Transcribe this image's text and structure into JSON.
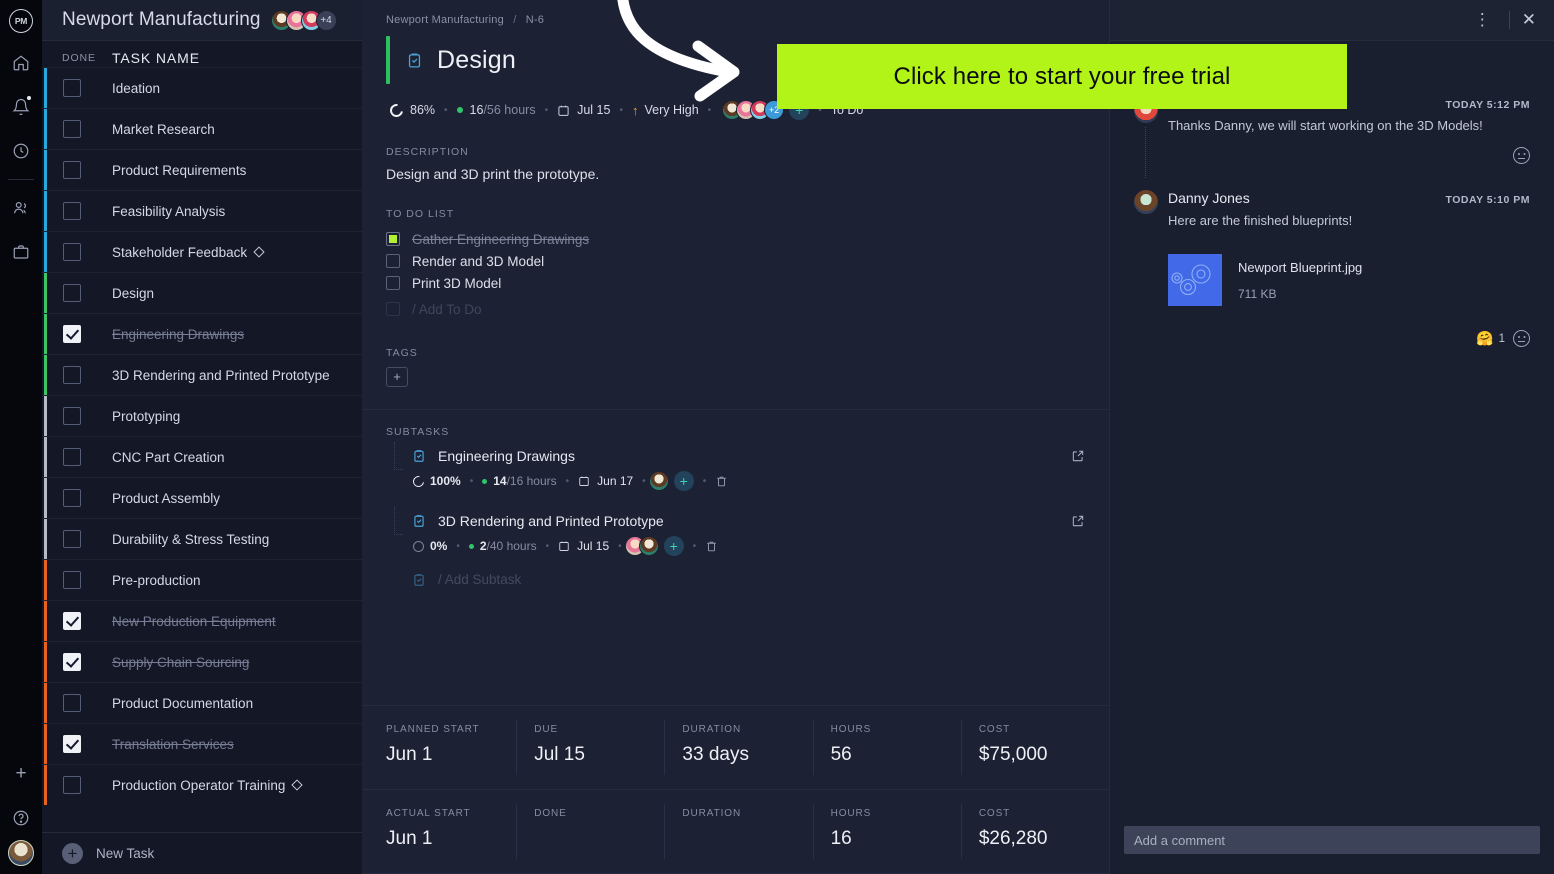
{
  "rail": {
    "logo_text": "PM",
    "items": [
      {
        "name": "home-icon",
        "label": "Home"
      },
      {
        "name": "notifications-icon",
        "label": "Notifications"
      },
      {
        "name": "time-icon",
        "label": "Timesheets"
      },
      {
        "name": "people-icon",
        "label": "People"
      },
      {
        "name": "portfolio-icon",
        "label": "Portfolio"
      }
    ],
    "add_label": "+",
    "help_label": "?"
  },
  "tasklist": {
    "project_title": "Newport Manufacturing",
    "avatars_overflow": "+4",
    "columns": {
      "done": "DONE",
      "task_name": "TASK NAME"
    },
    "new_task_label": "New Task",
    "rows": [
      {
        "name": "Ideation",
        "done": false,
        "color": "#29a8dc",
        "milestone": false
      },
      {
        "name": "Market Research",
        "done": false,
        "color": "#29a8dc",
        "milestone": false
      },
      {
        "name": "Product Requirements",
        "done": false,
        "color": "#29a8dc",
        "milestone": false
      },
      {
        "name": "Feasibility Analysis",
        "done": false,
        "color": "#29a8dc",
        "milestone": false
      },
      {
        "name": "Stakeholder Feedback",
        "done": false,
        "color": "#29a8dc",
        "milestone": true
      },
      {
        "name": "Design",
        "done": false,
        "color": "#3fc463",
        "milestone": false
      },
      {
        "name": "Engineering Drawings",
        "done": true,
        "color": "#3fc463",
        "milestone": false
      },
      {
        "name": "3D Rendering and Printed Prototype",
        "done": false,
        "color": "#3fc463",
        "milestone": false
      },
      {
        "name": "Prototyping",
        "done": false,
        "color": "#b6bac7",
        "milestone": false
      },
      {
        "name": "CNC Part Creation",
        "done": false,
        "color": "#b6bac7",
        "milestone": false
      },
      {
        "name": "Product Assembly",
        "done": false,
        "color": "#b6bac7",
        "milestone": false
      },
      {
        "name": "Durability & Stress Testing",
        "done": false,
        "color": "#b6bac7",
        "milestone": false
      },
      {
        "name": "Pre-production",
        "done": false,
        "color": "#e8621f",
        "milestone": false
      },
      {
        "name": "New Production Equipment",
        "done": true,
        "color": "#e8621f",
        "milestone": false
      },
      {
        "name": "Supply Chain Sourcing",
        "done": true,
        "color": "#e8621f",
        "milestone": false
      },
      {
        "name": "Product Documentation",
        "done": false,
        "color": "#e8621f",
        "milestone": false
      },
      {
        "name": "Translation Services",
        "done": true,
        "color": "#e8621f",
        "milestone": false
      },
      {
        "name": "Production Operator Training",
        "done": false,
        "color": "#e8621f",
        "milestone": true
      }
    ]
  },
  "detail": {
    "breadcrumb": {
      "project": "Newport Manufacturing",
      "separator": "/",
      "task_id": "N-6"
    },
    "title": "Design",
    "accent_color": "#2fbf5e",
    "meta": {
      "progress": "86%",
      "hours_done": "16",
      "hours_total": "/56 hours",
      "due_date": "Jul 15",
      "priority": "Very High",
      "assignee_overflow": "+2",
      "status": "To Do"
    },
    "description": {
      "label": "DESCRIPTION",
      "text": "Design and 3D print the prototype."
    },
    "todo": {
      "label": "TO DO LIST",
      "items": [
        {
          "text": "Gather Engineering Drawings",
          "done": true
        },
        {
          "text": "Render and 3D Model",
          "done": false
        },
        {
          "text": "Print 3D Model",
          "done": false
        }
      ],
      "add_placeholder": "/ Add To Do"
    },
    "tags": {
      "label": "TAGS",
      "add_label": "+"
    },
    "subtasks": {
      "label": "SUBTASKS",
      "add_placeholder": "/ Add Subtask",
      "items": [
        {
          "name": "Engineering Drawings",
          "progress": "100%",
          "hours_done": "14",
          "hours_total": "/16 hours",
          "date": "Jun 17"
        },
        {
          "name": "3D Rendering and Printed Prototype",
          "progress": "0%",
          "hours_done": "2",
          "hours_total": "/40 hours",
          "date": "Jul 15"
        }
      ]
    },
    "stats": [
      [
        {
          "key": "PLANNED START",
          "value": "Jun 1"
        },
        {
          "key": "DUE",
          "value": "Jul 15"
        },
        {
          "key": "DURATION",
          "value": "33 days"
        },
        {
          "key": "HOURS",
          "value": "56"
        },
        {
          "key": "COST",
          "value": "$75,000"
        }
      ],
      [
        {
          "key": "ACTUAL START",
          "value": "Jun 1"
        },
        {
          "key": "DONE",
          "value": ""
        },
        {
          "key": "DURATION",
          "value": ""
        },
        {
          "key": "HOURS",
          "value": "16"
        },
        {
          "key": "COST",
          "value": "$26,280"
        }
      ]
    ]
  },
  "comments": {
    "items": [
      {
        "author": "",
        "time": "TODAY 5:12 PM",
        "body": "Thanks Danny, we will start working on the 3D Models!",
        "avatar": "c-av-red"
      },
      {
        "author": "Danny Jones",
        "time": "TODAY 5:10 PM",
        "body": "Here are the finished blueprints!",
        "avatar": "c-av-danny"
      }
    ],
    "attachment": {
      "filename": "Newport Blueprint.jpg",
      "size": "711 KB"
    },
    "reaction": {
      "emoji": "🤗",
      "count": "1"
    },
    "compose_placeholder": "Add a comment"
  },
  "promo": {
    "text": "Click here to start your free trial",
    "background": "#b2f318"
  }
}
